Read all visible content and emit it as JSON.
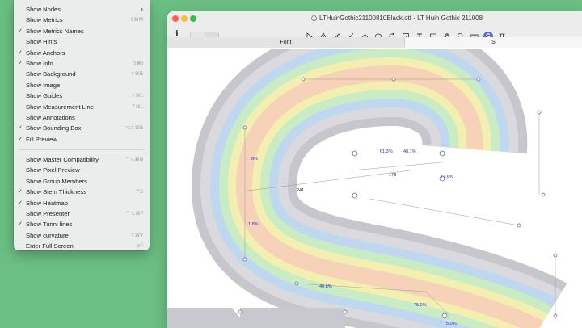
{
  "window": {
    "title": "LTHuinGothic21100810Black.otf - LT Huin Gothic 211008"
  },
  "toolbar": {
    "info_icon": "i",
    "tools": [
      {
        "name": "select-tool-icon"
      },
      {
        "name": "draw-tool-icon"
      },
      {
        "name": "pencil-tool-icon"
      },
      {
        "name": "brush-tool-icon"
      },
      {
        "name": "eraser-tool-icon"
      },
      {
        "name": "shape-tool-icon"
      },
      {
        "name": "rotate-tool-icon"
      },
      {
        "name": "scale-tool-icon"
      },
      {
        "name": "text-tool-icon"
      },
      {
        "name": "annotation-tool-icon"
      },
      {
        "name": "hand-tool-icon"
      },
      {
        "name": "zoom-tool-icon"
      },
      {
        "name": "measure-tool-icon"
      },
      {
        "name": "tunni-plugin-icon",
        "active": true
      },
      {
        "name": "stem-thickness-icon"
      }
    ]
  },
  "tabs": {
    "font": "Font",
    "glyph": "S"
  },
  "canvas": {
    "labels": {
      "stem": "241",
      "counter": "178",
      "t1": "61.3%",
      "t2": "48.1%",
      "t3": "77.6%",
      "t4": "8%",
      "t5": "1.8%",
      "t6": "40.8%",
      "t7": "75.0%",
      "t8": "75.0%"
    }
  },
  "colors": {
    "desktop": "#6cbf84",
    "tunni_blue": "#2b2fc9",
    "active_tool": "#5468c9"
  },
  "menu": {
    "items": [
      {
        "label": "Show Nodes",
        "checked": false,
        "shortcut": "",
        "submenu": true
      },
      {
        "label": "Show Metrics",
        "checked": false,
        "shortcut": "⇧⌘M"
      },
      {
        "label": "Show Metrics Names",
        "checked": true,
        "shortcut": ""
      },
      {
        "label": "Show Hints",
        "checked": false,
        "shortcut": ""
      },
      {
        "label": "Show Anchors",
        "checked": true,
        "shortcut": ""
      },
      {
        "label": "Show Info",
        "checked": true,
        "shortcut": "⇧⌘I"
      },
      {
        "label": "Show Background",
        "checked": false,
        "shortcut": "⇧⌘B"
      },
      {
        "label": "Show Image",
        "checked": false,
        "shortcut": ""
      },
      {
        "label": "Show Guides",
        "checked": false,
        "shortcut": "⇧⌘L"
      },
      {
        "label": "Show Measurement Line",
        "checked": false,
        "shortcut": "^⌘L"
      },
      {
        "label": "Show Annotations",
        "checked": false,
        "shortcut": ""
      },
      {
        "label": "Show Bounding Box",
        "checked": true,
        "shortcut": "⌥⇧⌘B"
      },
      {
        "label": "Fill Preview",
        "checked": true,
        "shortcut": ""
      },
      {
        "separator": true
      },
      {
        "label": "Show Master Compatibility",
        "checked": false,
        "shortcut": "^⌥⌘N"
      },
      {
        "label": "Show Pixel Preview",
        "checked": false,
        "shortcut": ""
      },
      {
        "label": "Show Group Members",
        "checked": false,
        "shortcut": ""
      },
      {
        "label": "Show Stem Thickness",
        "checked": true,
        "shortcut": "^S"
      },
      {
        "label": "Show Heatmap",
        "checked": true,
        "shortcut": ""
      },
      {
        "label": "Show Presenter",
        "checked": false,
        "shortcut": "^⌥⌘P"
      },
      {
        "label": "Show Tunni lines",
        "checked": true,
        "shortcut": ""
      },
      {
        "label": "Show curvature",
        "checked": false,
        "shortcut": "⇧⌘V"
      },
      {
        "label": "Enter Full Screen",
        "checked": false,
        "shortcut": "⊕F"
      }
    ]
  }
}
